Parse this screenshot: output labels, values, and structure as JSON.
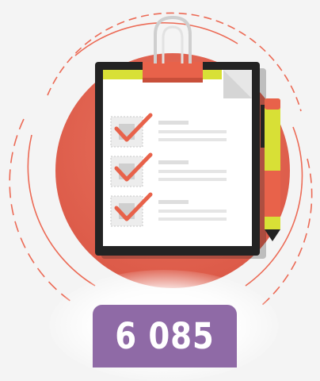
{
  "illustration": {
    "icon": "clipboard-checklist-icon",
    "checklist_items": 3,
    "accent_color": "#e8624a",
    "circle_color": "#e26450",
    "highlight_color": "#d8e036"
  },
  "counter": {
    "value": "6 085",
    "badge_color": "#8f6aa6"
  }
}
